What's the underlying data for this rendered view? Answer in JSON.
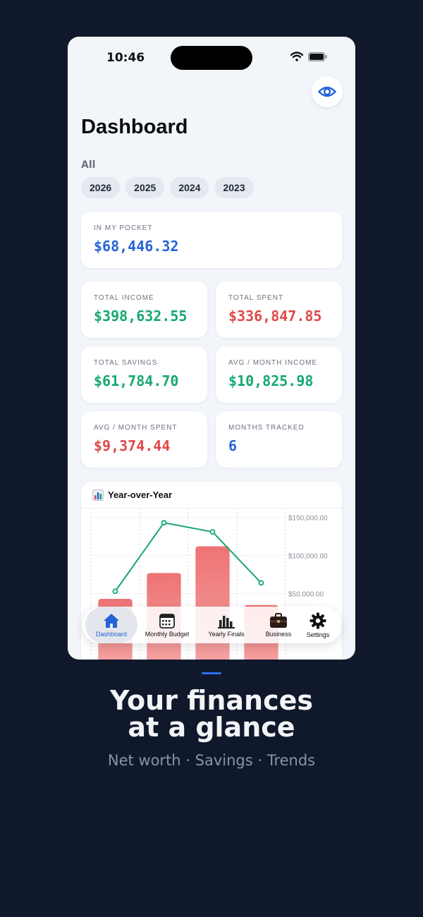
{
  "status": {
    "time": "10:46"
  },
  "header": {
    "title": "Dashboard",
    "filter_all": "All"
  },
  "years": [
    "2026",
    "2025",
    "2024",
    "2023"
  ],
  "pocket": {
    "label": "IN MY POCKET",
    "value": "$68,446.32"
  },
  "stats": [
    {
      "label": "TOTAL INCOME",
      "value": "$398,632.55",
      "color": "green"
    },
    {
      "label": "TOTAL SPENT",
      "value": "$336,847.85",
      "color": "red"
    },
    {
      "label": "TOTAL SAVINGS",
      "value": "$61,784.70",
      "color": "green"
    },
    {
      "label": "AVG / MONTH INCOME",
      "value": "$10,825.98",
      "color": "green"
    },
    {
      "label": "AVG / MONTH SPENT",
      "value": "$9,374.44",
      "color": "red"
    },
    {
      "label": "MONTHS TRACKED",
      "value": "6",
      "color": "blue"
    }
  ],
  "chart_card": {
    "icon": "bar-chart-icon",
    "title": "Year-over-Year"
  },
  "chart_data": {
    "type": "bar",
    "title": "Year-over-Year",
    "categories": [],
    "series": [
      {
        "type": "bar",
        "values": [
          43000,
          77000,
          112000,
          35000
        ]
      },
      {
        "type": "line",
        "values": [
          53000,
          143000,
          131000,
          64000
        ]
      }
    ],
    "ylim": [
      0,
      150000
    ],
    "yticks": [
      "$150,000.00",
      "$100,000.00",
      "$50,000.00"
    ],
    "grid": true
  },
  "tabs": [
    {
      "label": "Dashboard",
      "icon": "house-icon",
      "active": true
    },
    {
      "label": "Monthly Budget",
      "icon": "calendar-icon",
      "active": false
    },
    {
      "label": "Yearly Finals",
      "icon": "bar-chart-icon",
      "active": false
    },
    {
      "label": "Business",
      "icon": "briefcase-icon",
      "active": false
    },
    {
      "label": "Settings",
      "icon": "gear-icon",
      "active": false
    }
  ],
  "promo": {
    "headline_line1": "Your finances",
    "headline_line2": "at a glance",
    "subline": "Net worth · Savings · Trends"
  },
  "colors": {
    "accent": "#2563d6",
    "income": "#16a870",
    "spent": "#e04848",
    "background": "#10182b"
  }
}
